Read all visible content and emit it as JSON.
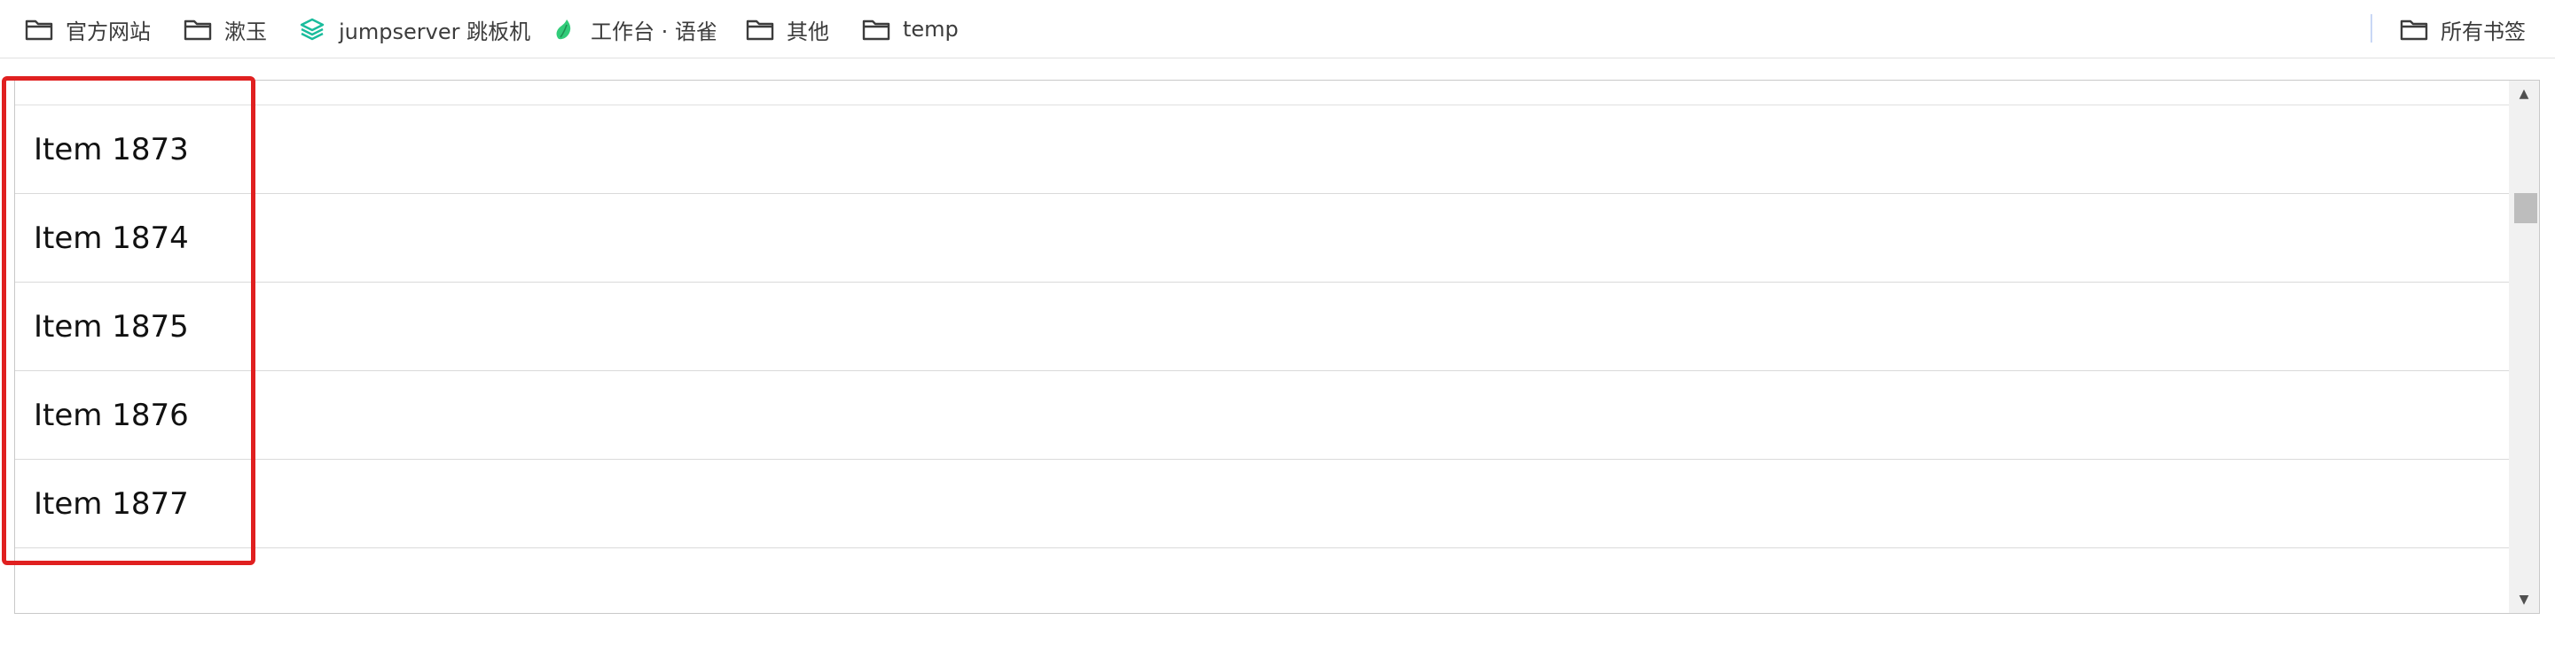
{
  "bookmarks_bar": {
    "items": [
      {
        "label": "官方网站",
        "icon": "folder-icon"
      },
      {
        "label": "漱玉",
        "icon": "folder-icon"
      },
      {
        "label": "jumpserver 跳板机",
        "icon": "jumpserver-logo-icon"
      },
      {
        "label": "工作台 · 语雀",
        "icon": "yuque-logo-icon"
      },
      {
        "label": "其他",
        "icon": "folder-icon"
      },
      {
        "label": "temp",
        "icon": "folder-icon"
      }
    ],
    "all_bookmarks": {
      "label": "所有书签",
      "icon": "folder-icon"
    }
  },
  "list": {
    "items": [
      {
        "label": "Item 1873"
      },
      {
        "label": "Item 1874"
      },
      {
        "label": "Item 1875"
      },
      {
        "label": "Item 1876"
      },
      {
        "label": "Item 1877"
      }
    ]
  },
  "colors": {
    "highlight_border": "#e02020",
    "jumpserver_icon": "#1abc9c",
    "yuque_icon": "#31cc79"
  }
}
